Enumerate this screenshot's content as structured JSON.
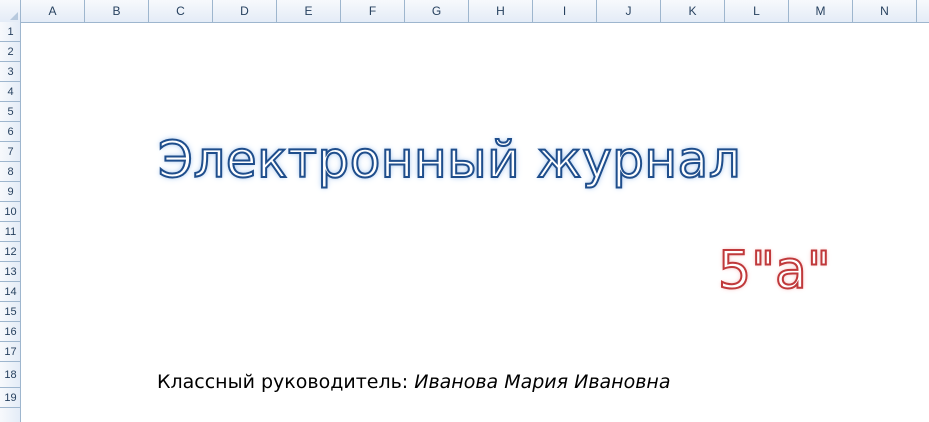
{
  "columns": [
    "A",
    "B",
    "C",
    "D",
    "E",
    "F",
    "G",
    "H",
    "I",
    "J",
    "K",
    "L",
    "M",
    "N"
  ],
  "rows": [
    "1",
    "2",
    "3",
    "4",
    "5",
    "6",
    "7",
    "8",
    "9",
    "10",
    "11",
    "12",
    "13",
    "14",
    "15",
    "16",
    "17",
    "18",
    "19"
  ],
  "content": {
    "title": "Электронный журнал",
    "class_label": "5\"а\"",
    "teacher_label": "Классный руководитель: ",
    "teacher_name": "Иванова Мария Ивановна"
  },
  "colors": {
    "title_outline": "#1f4e8c",
    "class_outline": "#c0393b",
    "header_bg": "#e4ecf7",
    "grid_line": "#9eb6ce"
  }
}
